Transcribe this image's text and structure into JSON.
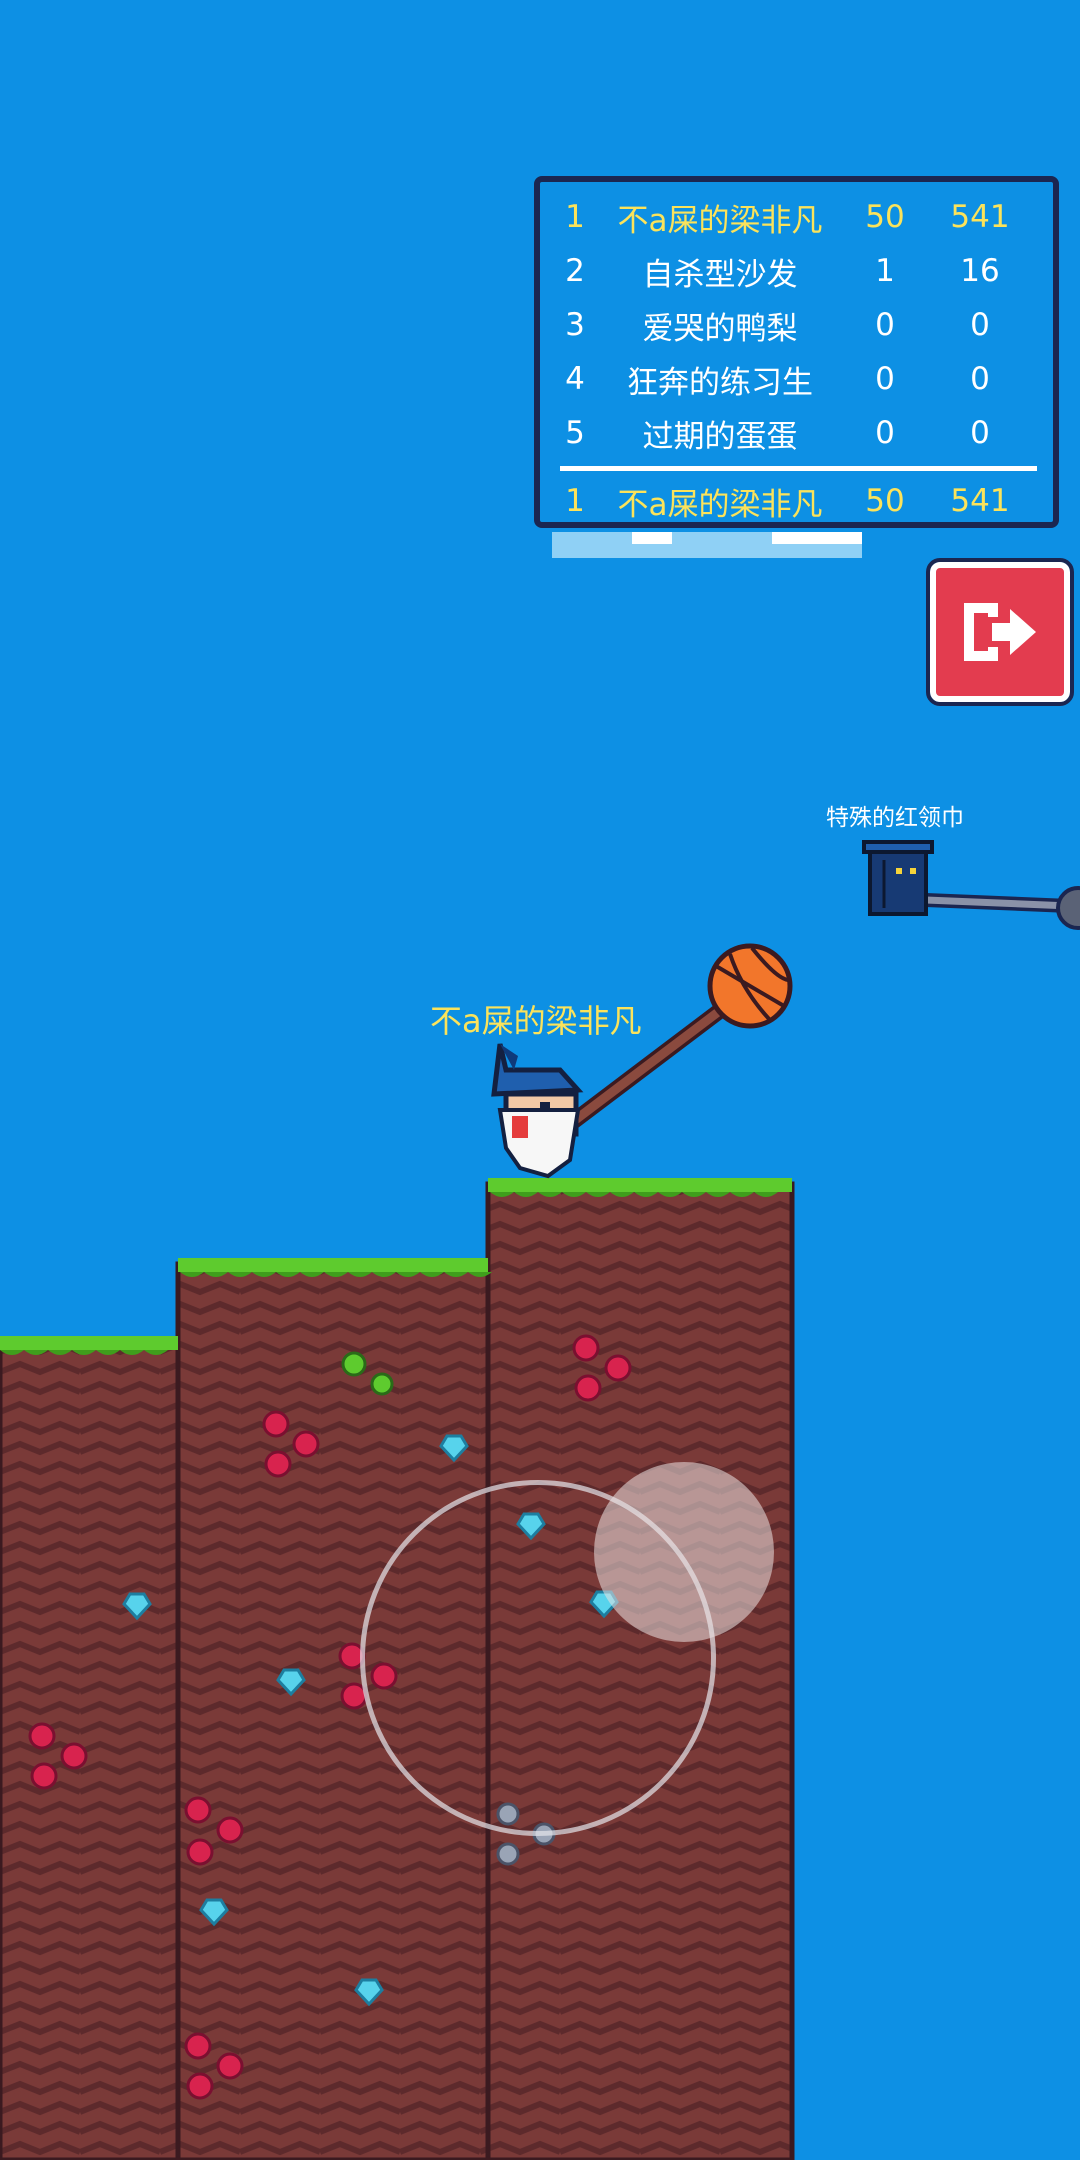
{
  "leaderboard": {
    "rows": [
      {
        "rank": "1",
        "name": "不a屎的梁非凡",
        "score": "50",
        "total": "541"
      },
      {
        "rank": "2",
        "name": "自杀型沙发",
        "score": "1",
        "total": "16"
      },
      {
        "rank": "3",
        "name": "爱哭的鸭梨",
        "score": "0",
        "total": "0"
      },
      {
        "rank": "4",
        "name": "狂奔的练习生",
        "score": "0",
        "total": "0"
      },
      {
        "rank": "5",
        "name": "过期的蛋蛋",
        "score": "0",
        "total": "0"
      }
    ],
    "self": {
      "rank": "1",
      "name": "不a屎的梁非凡",
      "score": "50",
      "total": "541"
    }
  },
  "player": {
    "name": "不a屎的梁非凡"
  },
  "enemy": {
    "name": "特殊的红领巾"
  },
  "exit_button": {
    "icon": "exit-icon"
  },
  "colors": {
    "sky": "#0d90e4",
    "dirt": "#7a3a38",
    "grass": "#5ecb2e",
    "highlight": "#fbe35b",
    "exit": "#e33c4f"
  }
}
